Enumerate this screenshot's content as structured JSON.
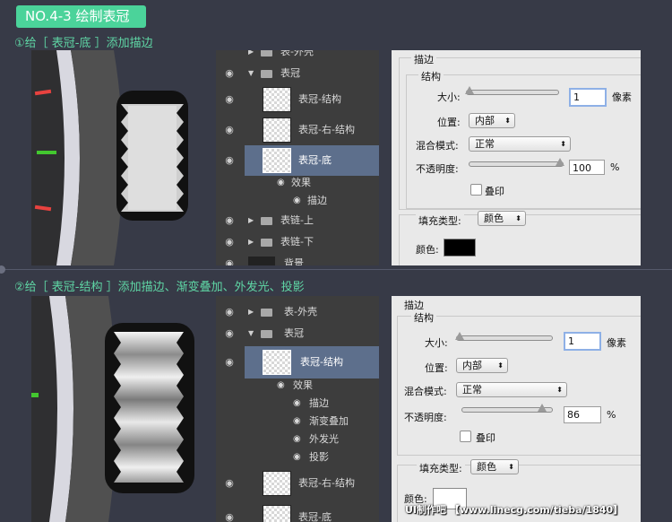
{
  "badge": {
    "text": "NO.4-3 绘制表冠"
  },
  "step1": {
    "label": "①给［ 表冠-底 ］添加描边"
  },
  "step2": {
    "label": "②给［ 表冠-结构 ］添加描边、渐变叠加、外发光、投影"
  },
  "layers1": {
    "rows": [
      {
        "name": "表-外壳"
      },
      {
        "name": "表冠"
      },
      {
        "name": "表冠-结构"
      },
      {
        "name": "表冠-右-结构"
      },
      {
        "name": "表冠-底"
      },
      {
        "name": "效果"
      },
      {
        "name": "描边"
      },
      {
        "name": "表链-上"
      },
      {
        "name": "表链-下"
      },
      {
        "name": "背景"
      }
    ]
  },
  "layers2": {
    "rows": [
      {
        "name": "表-外壳"
      },
      {
        "name": "表冠"
      },
      {
        "name": "表冠-结构"
      },
      {
        "name": "效果"
      },
      {
        "name": "描边"
      },
      {
        "name": "渐变叠加"
      },
      {
        "name": "外发光"
      },
      {
        "name": "投影"
      },
      {
        "name": "表冠-右-结构"
      },
      {
        "name": "表冠-底"
      }
    ]
  },
  "panel1": {
    "title": "描边",
    "struct": "结构",
    "size_label": "大小:",
    "size_value": "1",
    "size_unit": "像素",
    "pos_label": "位置:",
    "pos_value": "内部",
    "blend_label": "混合模式:",
    "blend_value": "正常",
    "opacity_label": "不透明度:",
    "opacity_value": "100",
    "opacity_unit": "%",
    "overprint_label": "叠印",
    "fill_type_label": "填充类型:",
    "fill_type_value": "颜色",
    "color_label": "颜色:",
    "color_swatch": "#000000"
  },
  "panel2": {
    "title": "描边",
    "struct": "结构",
    "size_label": "大小:",
    "size_value": "1",
    "size_unit": "像素",
    "pos_label": "位置:",
    "pos_value": "内部",
    "blend_label": "混合模式:",
    "blend_value": "正常",
    "opacity_label": "不透明度:",
    "opacity_value": "86",
    "opacity_unit": "%",
    "overprint_label": "叠印",
    "fill_type_label": "填充类型:",
    "fill_type_value": "颜色",
    "color_label": "颜色:",
    "color_swatch": "#ffffff"
  },
  "watermark": {
    "text": "UI制作吧 【www.linecg.com/tieba/1840】"
  },
  "colors": {
    "bg": "#373a47",
    "accent": "#4bd39a",
    "layer_bg": "#3d3d3d",
    "layer_sel": "#5d6f8c",
    "dialog": "#e9e9e9",
    "tick_red": "#e8423f",
    "tick_green": "#43c72f"
  }
}
